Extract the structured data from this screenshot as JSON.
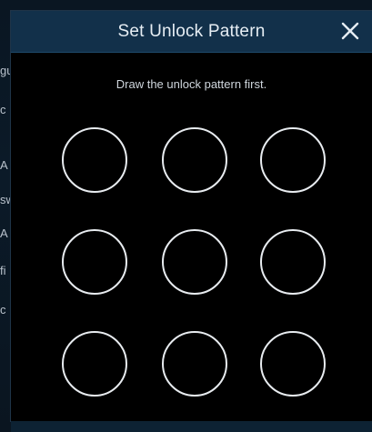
{
  "background": {
    "labels": [
      "gu",
      "c",
      "A",
      "sw",
      "A",
      "fi",
      "c"
    ]
  },
  "dialog": {
    "title": "Set Unlock Pattern",
    "close_icon": "close-icon",
    "instruction": "Draw the unlock pattern first.",
    "pattern_dots": 9
  },
  "colors": {
    "header_bg": "#12304a",
    "dialog_bg": "#000000",
    "dot_stroke": "#e8ecf0",
    "text": "#e6edf3"
  }
}
